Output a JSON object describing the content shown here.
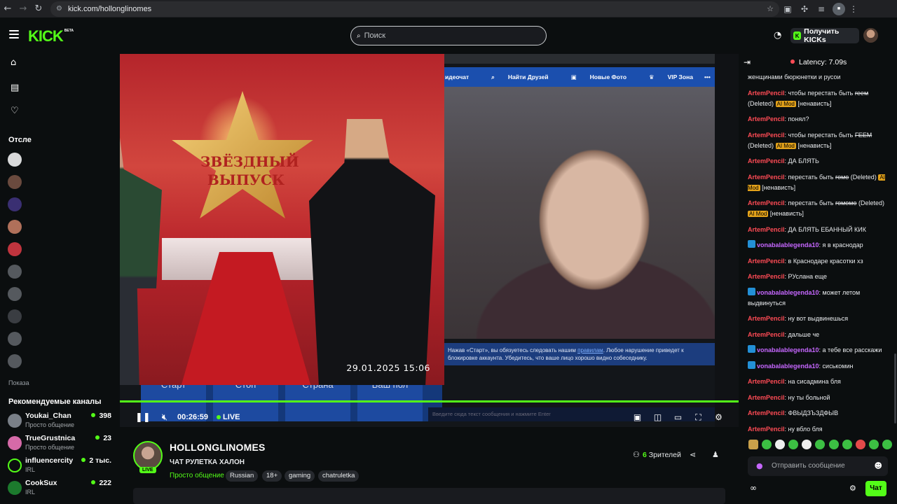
{
  "browser": {
    "url": "kick.com/hollonglinomes"
  },
  "header": {
    "logo": "KICK",
    "logo_sup": "BETA",
    "search_placeholder": "Поиск",
    "get_kicks_label": "Получить KICKs"
  },
  "sidebar": {
    "following_title": "Отсле",
    "show_more": "Показа",
    "recommended_title": "Рекомендуемые каналы",
    "recommended": [
      {
        "name": "Youkai_Chan",
        "category": "Просто общение",
        "viewers": "398",
        "color": "#7a8088"
      },
      {
        "name": "TrueGrustnica",
        "category": "Просто общение",
        "viewers": "23",
        "color": "#d56aa8"
      },
      {
        "name": "influencercity",
        "category": "IRL",
        "viewers": "2 тыс.",
        "color": "#53fc18"
      },
      {
        "name": "CookSux",
        "category": "IRL",
        "viewers": "222",
        "color": "#1c7a2d"
      }
    ]
  },
  "player": {
    "stream_nav": [
      "идеочат",
      "Найти Друзей",
      "Новые Фото",
      "VIP Зона",
      "•••"
    ],
    "notice_text_1": "Нажав «Старт», вы обязуетесь следовать нашим ",
    "notice_link": "правилам",
    "notice_text_2": ". Любое нарушение приведет к блокировке аккаунта. Убедитесь, что ваше лицо хорошо видно собеседнику.",
    "stream_buttons": [
      "Старт",
      "Стоп",
      "Страна",
      "Ваш пол"
    ],
    "stream_input_placeholder": "Введите сюда текст сообщения и нажмите Enter",
    "overlay_text": "ЗВЁЗДНЫЙ ВЫПУСК",
    "overlay_date": "29.01.2025  15:06",
    "time": "00:26:59",
    "live_label": "LIVE"
  },
  "channel": {
    "name": "HOLLONGLINOMES",
    "live_badge": "LIVE",
    "title": "ЧАТ РУЛЕТКА ХАЛОН",
    "category": "Просто общение",
    "tags": [
      "Russian",
      "18+",
      "gaming",
      "chatruletka"
    ],
    "viewers_count": "6",
    "viewers_label": "Зрителей"
  },
  "chat": {
    "latency": "Latency: 7.09s",
    "input_placeholder": "Отправить сообщение",
    "send_label": "Чат",
    "colors": {
      "artem": "#ff4b55",
      "vona": "#c667ff"
    },
    "messages": [
      {
        "user": "",
        "text": "женщинами бюрюнетки и русои",
        "color": "artem"
      },
      {
        "user": "ArtemPencil",
        "text": ": чтобы перестать быть ",
        "del": "геем",
        "deleted": " (Deleted) ",
        "ai": "AI Mod",
        "tail": " [ненависть]",
        "color": "artem"
      },
      {
        "user": "ArtemPencil",
        "text": ": понял?",
        "color": "artem"
      },
      {
        "user": "ArtemPencil",
        "text": ": чтобы перестать быть ",
        "del": "ГЕЕМ",
        "deleted": " (Deleted) ",
        "ai": "AI Mod",
        "tail": " [ненависть]",
        "color": "artem"
      },
      {
        "user": "ArtemPencil",
        "text": ": ДА БЛЯТЬ",
        "color": "artem"
      },
      {
        "user": "ArtemPencil",
        "text": ": перестать быть ",
        "del": "гомо",
        "deleted": " (Deleted) ",
        "ai": "AI Mod",
        "tail": " [ненависть]",
        "color": "artem"
      },
      {
        "user": "ArtemPencil",
        "text": ": перестать быть ",
        "del": "гомомо",
        "deleted": " (Deleted) ",
        "ai": "AI Mod",
        "tail": " [ненависть]",
        "color": "artem"
      },
      {
        "user": "ArtemPencil",
        "text": ": ДА БЛЯТЬ ЕБАННЫЙ КИК",
        "color": "artem"
      },
      {
        "user": "vonabalablegenda10",
        "text": ": я в краснодар",
        "color": "vona",
        "badge": true
      },
      {
        "user": "ArtemPencil",
        "text": ": в Краснодаре красотки хз",
        "color": "artem"
      },
      {
        "user": "ArtemPencil",
        "text": ": РУслана еще",
        "color": "artem"
      },
      {
        "user": "vonabalablegenda10",
        "text": ": может летом выдвинуться",
        "color": "vona",
        "badge": true
      },
      {
        "user": "ArtemPencil",
        "text": ": ну вот выдвинешься",
        "color": "artem"
      },
      {
        "user": "ArtemPencil",
        "text": ": дальше че",
        "color": "artem"
      },
      {
        "user": "vonabalablegenda10",
        "text": ": а тебе все расскажи",
        "color": "vona",
        "badge": true
      },
      {
        "user": "vonabalablegenda10",
        "text": ": сиськомин",
        "color": "vona",
        "badge": true
      },
      {
        "user": "ArtemPencil",
        "text": ": на сисадмина бля",
        "color": "artem"
      },
      {
        "user": "ArtemPencil",
        "text": ": ну ты больной",
        "color": "artem"
      },
      {
        "user": "ArtemPencil",
        "text": ": ФВЫДЗЪЗДФЫВ",
        "color": "artem"
      },
      {
        "user": "ArtemPencil",
        "text": ": ну вбло бля",
        "color": "artem"
      }
    ]
  }
}
